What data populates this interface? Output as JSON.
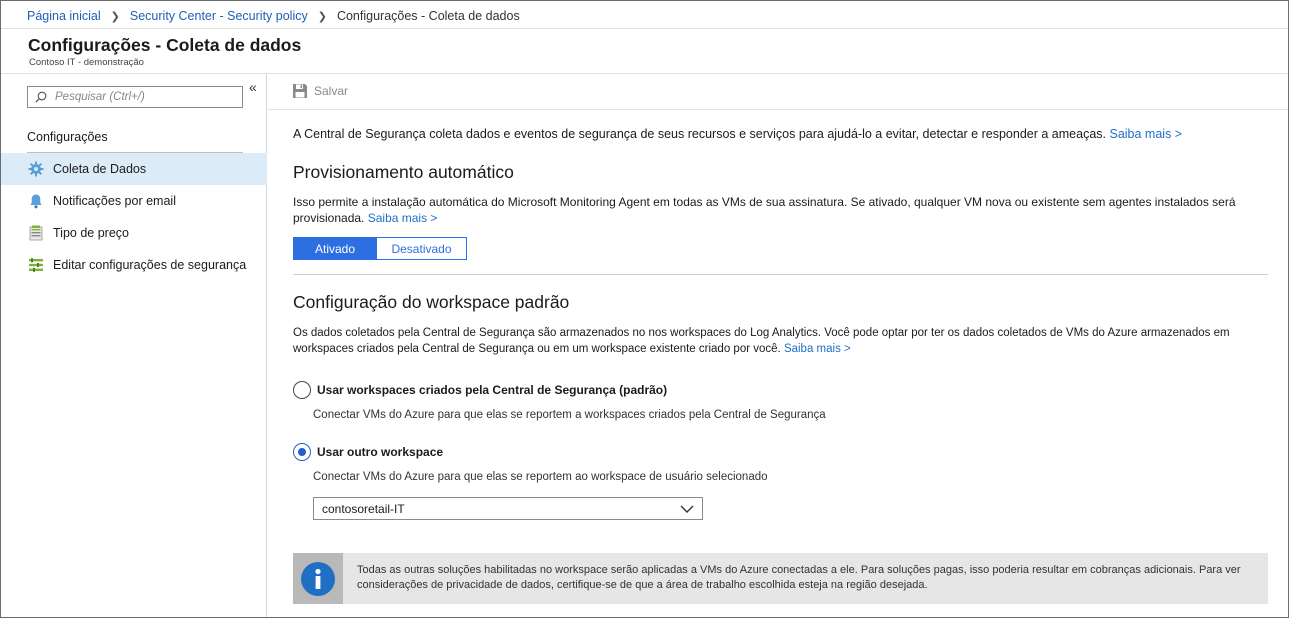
{
  "breadcrumb": {
    "home": "Página inicial",
    "policy": "Security Center - Security policy",
    "current": "Configurações - Coleta de dados"
  },
  "header": {
    "title": "Configurações - Coleta de dados",
    "subtitle": "Contoso IT - demonstração"
  },
  "sidebar": {
    "search_placeholder": "Pesquisar (Ctrl+/)",
    "collapse_glyph": "«",
    "heading": "Configurações",
    "items": [
      {
        "label": "Coleta de Dados",
        "icon": "gear-icon",
        "active": true
      },
      {
        "label": "Notificações por email",
        "icon": "bell-icon",
        "active": false
      },
      {
        "label": "Tipo de preço",
        "icon": "pricing-icon",
        "active": false
      },
      {
        "label": "Editar configurações de segurança",
        "icon": "settings-list-icon",
        "active": false
      }
    ]
  },
  "toolbar": {
    "save_label": "Salvar"
  },
  "main": {
    "intro_text": "A Central de Segurança coleta dados e eventos de segurança de seus recursos e serviços para ajudá-lo a evitar, detectar e responder a ameaças.",
    "intro_link": "Saiba mais >",
    "auto_title": "Provisionamento automático",
    "auto_text": "Isso permite a instalação automática do Microsoft Monitoring Agent em todas as VMs de sua assinatura. Se ativado, qualquer VM nova ou existente sem agentes instalados será provisionada.",
    "auto_link": "Saiba mais >",
    "toggle_on": "Ativado",
    "toggle_off": "Desativado",
    "ws_title": "Configuração do workspace padrão",
    "ws_text": "Os dados coletados pela Central de Segurança são armazenados no nos workspaces do Log Analytics. Você pode optar por ter os dados coletados de VMs do Azure armazenados em workspaces criados pela Central de Segurança ou em um workspace existente criado por você.",
    "ws_link": "Saiba mais >",
    "option1_label": "Usar workspaces criados pela Central de Segurança (padrão)",
    "option1_desc": "Conectar VMs do Azure para que elas se reportem a workspaces criados pela Central de Segurança",
    "option2_label": "Usar outro workspace",
    "option2_desc": "Conectar VMs do Azure para que elas se reportem ao workspace de usuário selecionado",
    "workspace_selected": "contosoretail-IT",
    "info_text": "Todas as outras soluções habilitadas no workspace serão aplicadas a VMs do Azure conectadas a ele. Para soluções pagas, isso poderia resultar em cobranças adicionais. Para ver considerações de privacidade de dados, certifique-se de que a área de trabalho escolhida esteja na região desejada."
  },
  "colors": {
    "accent": "#2d6fe0",
    "link": "#1f6fc5",
    "active_nav_bg": "#dcebf8",
    "info_bg": "#e6e6e6"
  }
}
